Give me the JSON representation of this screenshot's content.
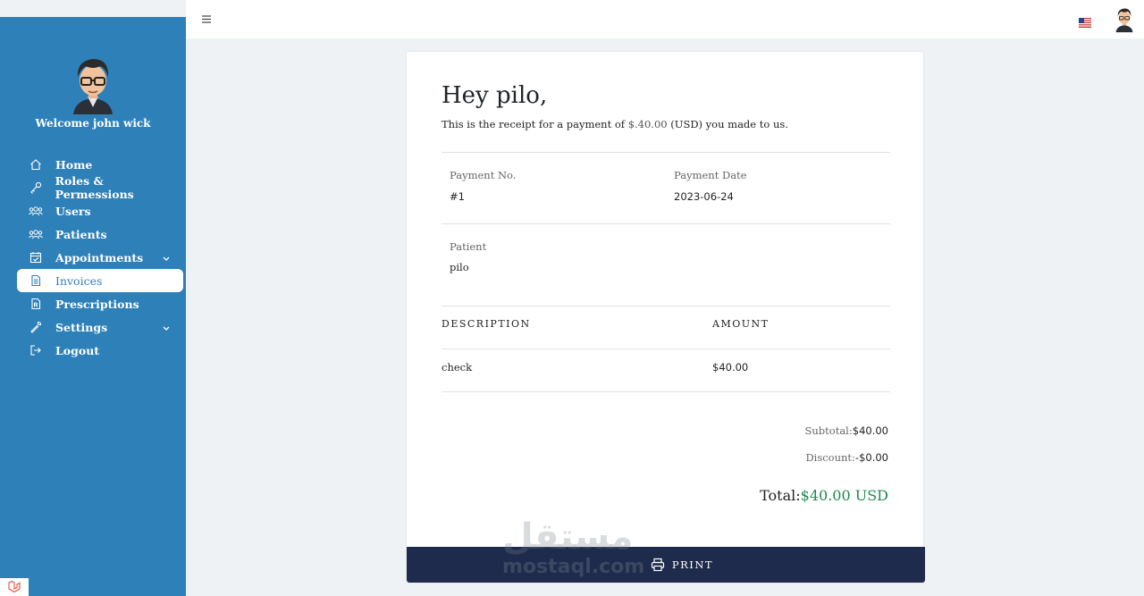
{
  "sidebar": {
    "welcome": "Welcome john wick",
    "items": [
      {
        "label": "Home",
        "icon": "home-icon"
      },
      {
        "label": "Roles & Permessions",
        "icon": "key-icon"
      },
      {
        "label": "Users",
        "icon": "users-icon"
      },
      {
        "label": "Patients",
        "icon": "patients-icon"
      },
      {
        "label": "Appointments",
        "icon": "calendar-check-icon",
        "has_submenu": true
      },
      {
        "label": "Invoices",
        "icon": "invoice-icon",
        "active": true
      },
      {
        "label": "Prescriptions",
        "icon": "prescription-icon"
      },
      {
        "label": "Settings",
        "icon": "wrench-icon",
        "has_submenu": true
      },
      {
        "label": "Logout",
        "icon": "logout-icon"
      }
    ]
  },
  "topbar": {
    "menu_icon": "hamburger-icon",
    "language": "us-flag-icon",
    "user_avatar": "avatar-icon"
  },
  "receipt": {
    "greeting": "Hey pilo,",
    "intro_before": "This is the receipt for a payment of ",
    "intro_amount": "$.40.00",
    "intro_after": " (USD) you made to us.",
    "payment_no_label": "Payment No.",
    "payment_no": "#1",
    "payment_date_label": "Payment Date",
    "payment_date": "2023-06-24",
    "patient_label": "Patient",
    "patient": "pilo",
    "table": {
      "headers": [
        "DESCRIPTION",
        "AMOUNT"
      ],
      "rows": [
        [
          "check",
          "$40.00"
        ]
      ]
    },
    "subtotal_label": "Subtotal:",
    "subtotal": "$40.00",
    "discount_label": "Discount:",
    "discount": "-$0.00",
    "total_label": "Total:",
    "total": "$40.00 USD",
    "print_label": "PRINT"
  },
  "watermark": {
    "arabic": "مستقل",
    "latin": "mostaql.com"
  },
  "colors": {
    "sidebar": "#2e80b8",
    "print_bar": "#1f2b4d",
    "total_green": "#1e8a4e",
    "background": "#eef2f4"
  }
}
